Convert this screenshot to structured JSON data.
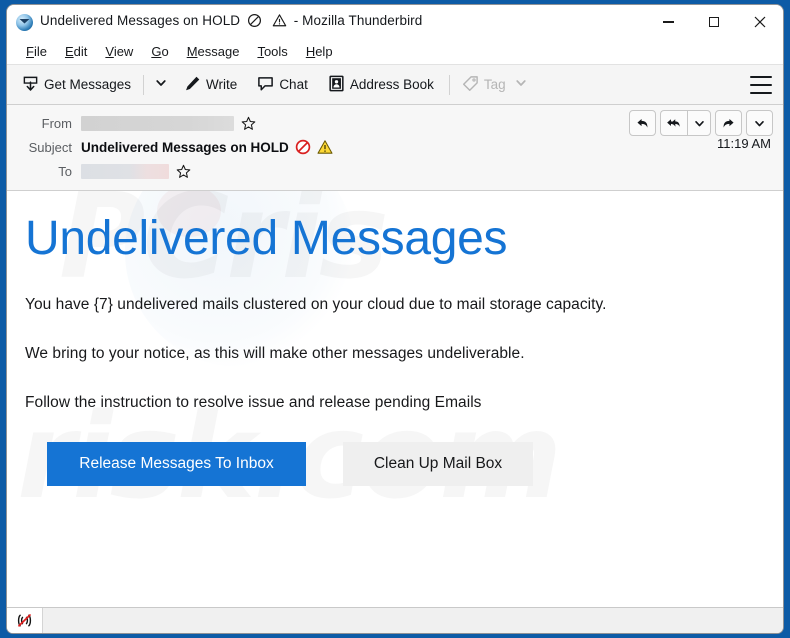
{
  "window": {
    "title": "Undelivered Messages on HOLD",
    "app_name": "- Mozilla Thunderbird",
    "app_icon": "thunderbird-icon",
    "title_blocked_icon": "no-entry-icon",
    "title_warning_icon": "warning-triangle-icon",
    "controls": {
      "minimize": "minimize-button",
      "maximize": "maximize-button",
      "close": "close-button"
    }
  },
  "menubar": {
    "items": [
      {
        "label": "File",
        "accesskey": "F"
      },
      {
        "label": "Edit",
        "accesskey": "E"
      },
      {
        "label": "View",
        "accesskey": "V"
      },
      {
        "label": "Go",
        "accesskey": "G"
      },
      {
        "label": "Message",
        "accesskey": "M"
      },
      {
        "label": "Tools",
        "accesskey": "T"
      },
      {
        "label": "Help",
        "accesskey": "H"
      }
    ]
  },
  "toolbar": {
    "get_messages": "Get Messages",
    "get_messages_icon": "download-inbox-icon",
    "get_messages_caret": "chevron-down-icon",
    "write": "Write",
    "write_icon": "pencil-icon",
    "chat": "Chat",
    "chat_icon": "speech-bubble-icon",
    "address_book": "Address Book",
    "address_book_icon": "contact-card-icon",
    "tag": "Tag",
    "tag_icon": "tag-icon",
    "tag_caret": "chevron-down-icon",
    "tag_disabled": true,
    "app_menu_icon": "hamburger-menu-icon"
  },
  "message_header": {
    "from_label": "From",
    "from_value": "",
    "from_redacted": true,
    "to_label": "To",
    "to_value": "",
    "to_redacted": true,
    "subject_label": "Subject",
    "subject_value": "Undelivered Messages on HOLD",
    "subject_blocked_icon": "no-entry-icon",
    "subject_warning_icon": "warning-triangle-icon",
    "star_icon": "star-outline-icon",
    "time": "11:19 AM",
    "actions": [
      {
        "name": "reply-button",
        "icon": "reply-arrow-icon"
      },
      {
        "name": "reply-all-button",
        "icon": "reply-all-arrow-icon"
      },
      {
        "name": "reply-all-dropdown",
        "icon": "chevron-down-icon"
      },
      {
        "name": "forward-button",
        "icon": "forward-arrow-icon"
      },
      {
        "name": "more-actions-dropdown",
        "icon": "chevron-down-icon"
      }
    ]
  },
  "message_body": {
    "heading": "Undelivered Messages",
    "heading_color": "#1574d4",
    "paragraphs": [
      "You have {7} undelivered mails clustered on your cloud due to mail storage capacity.",
      "We bring to your notice, as this will make other messages undeliverable.",
      "Follow the instruction to resolve issue and release pending Emails"
    ],
    "primary_button": "Release Messages To Inbox",
    "primary_button_color": "#1574d4",
    "secondary_button": "Clean Up Mail Box",
    "secondary_button_color": "#efefef",
    "watermark_text": "PCrisk.com",
    "watermark_line1": "PCris",
    "watermark_line2": "risk.com"
  },
  "statusbar": {
    "icon": "unencrypted-connection-icon",
    "text": ""
  }
}
